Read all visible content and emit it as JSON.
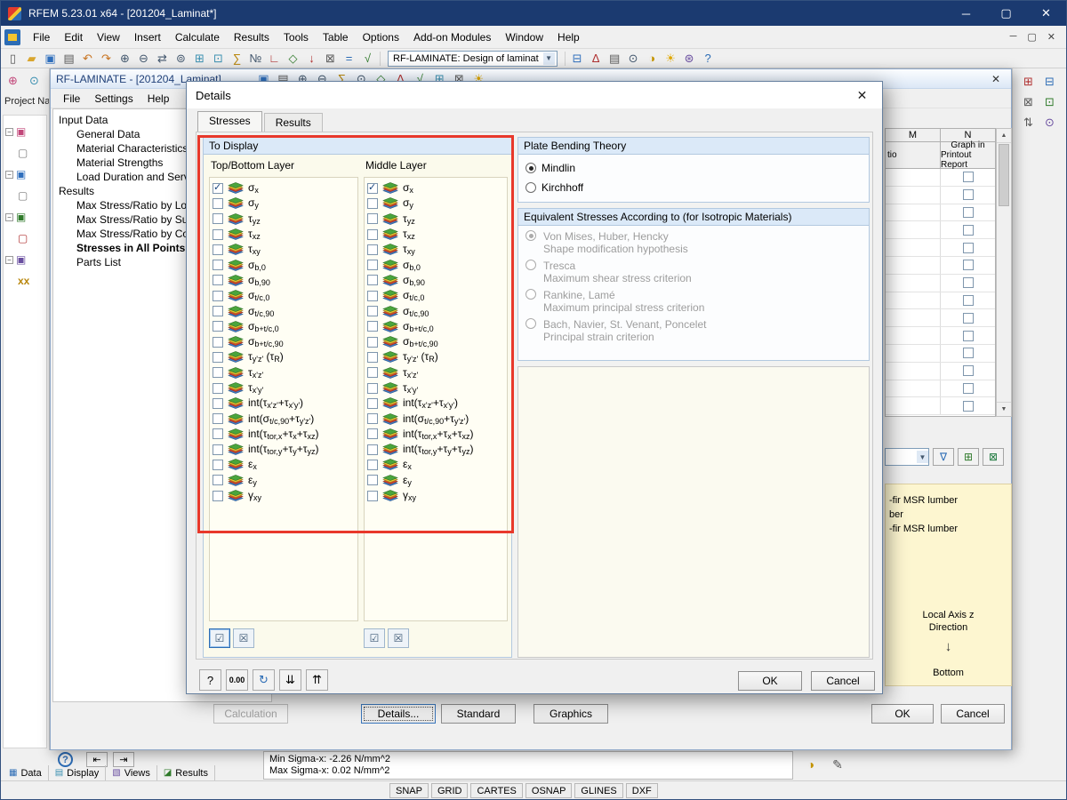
{
  "main_window": {
    "title": "RFEM 5.23.01 x64 - [201204_Laminat*]",
    "menu": [
      "File",
      "Edit",
      "View",
      "Insert",
      "Calculate",
      "Results",
      "Tools",
      "Table",
      "Options",
      "Add-on Modules",
      "Window",
      "Help"
    ]
  },
  "toolbar": {
    "module_selector": "RF-LAMINATE: Design of laminat",
    "icons_left": [
      {
        "name": "new-file-icon",
        "glyph": "▯",
        "color": "#5a5a5a"
      },
      {
        "name": "open-folder-icon",
        "glyph": "▰",
        "color": "#d9a62e"
      },
      {
        "name": "save-icon",
        "glyph": "▣",
        "color": "#2f6fbd"
      },
      {
        "name": "print-icon",
        "glyph": "▤",
        "color": "#5a5a5a"
      },
      {
        "name": "undo-icon",
        "glyph": "↶",
        "color": "#c8731f"
      },
      {
        "name": "redo-icon",
        "glyph": "↷",
        "color": "#c8731f"
      },
      {
        "name": "zoom-in-icon",
        "glyph": "⊕",
        "color": "#44586e"
      },
      {
        "name": "zoom-out-icon",
        "glyph": "⊖",
        "color": "#44586e"
      },
      {
        "name": "pan-icon",
        "glyph": "⇄",
        "color": "#44586e"
      },
      {
        "name": "rotate-view-icon",
        "glyph": "⊚",
        "color": "#44586e"
      },
      {
        "name": "grid-icon",
        "glyph": "⊞",
        "color": "#3a8fb0"
      },
      {
        "name": "snap-icon",
        "glyph": "⊡",
        "color": "#3a8fb0"
      },
      {
        "name": "sum-icon",
        "glyph": "∑",
        "color": "#b8860b"
      },
      {
        "name": "numbering-icon",
        "glyph": "№",
        "color": "#44586e"
      },
      {
        "name": "axes-icon",
        "glyph": "∟",
        "color": "#b03030"
      },
      {
        "name": "surface-icon",
        "glyph": "◇",
        "color": "#2f7a2a"
      },
      {
        "name": "load-icon",
        "glyph": "↓",
        "color": "#b03030"
      },
      {
        "name": "mesh-icon",
        "glyph": "⊠",
        "color": "#5a5a5a"
      },
      {
        "name": "calculate-icon",
        "glyph": "=",
        "color": "#2c6cb5"
      },
      {
        "name": "results-icon",
        "glyph": "√",
        "color": "#2f7a2a"
      }
    ],
    "icons_right": [
      {
        "name": "tables-icon",
        "glyph": "⊟",
        "color": "#2f6fbd"
      },
      {
        "name": "chart-icon",
        "glyph": "∆",
        "color": "#b03030"
      },
      {
        "name": "printout-report-icon",
        "glyph": "▤",
        "color": "#5a5a5a"
      },
      {
        "name": "camera-icon",
        "glyph": "⊙",
        "color": "#44586e"
      },
      {
        "name": "render-icon",
        "glyph": "◑",
        "color": "#c69500"
      },
      {
        "name": "light-icon",
        "glyph": "☀",
        "color": "#e0a800"
      },
      {
        "name": "modules-icon",
        "glyph": "⊛",
        "color": "#6a4fa0"
      },
      {
        "name": "help-icon",
        "glyph": "?",
        "color": "#2c6cb5"
      }
    ],
    "title_strip_icons": [
      {
        "name": "strip-save-icon",
        "glyph": "▣",
        "color": "#2f6fbd"
      },
      {
        "name": "strip-print-icon",
        "glyph": "▤",
        "color": "#5a5a5a"
      },
      {
        "name": "strip-zoom-in-icon",
        "glyph": "⊕",
        "color": "#44586e"
      },
      {
        "name": "strip-zoom-out-icon",
        "glyph": "⊖",
        "color": "#44586e"
      },
      {
        "name": "strip-sum-icon",
        "glyph": "∑",
        "color": "#b8860b"
      },
      {
        "name": "strip-camera-icon",
        "glyph": "⊙",
        "color": "#44586e"
      },
      {
        "name": "strip-surface-icon",
        "glyph": "◇",
        "color": "#2f7a2a"
      },
      {
        "name": "strip-chart-icon",
        "glyph": "∆",
        "color": "#b03030"
      },
      {
        "name": "strip-results-icon",
        "glyph": "√",
        "color": "#2f7a2a"
      },
      {
        "name": "strip-grid-icon",
        "glyph": "⊞",
        "color": "#3a8fb0"
      },
      {
        "name": "strip-mesh-icon",
        "glyph": "⊠",
        "color": "#5a5a5a"
      },
      {
        "name": "strip-light-icon",
        "glyph": "☀",
        "color": "#e0a800"
      }
    ],
    "side_icons": [
      {
        "name": "side-display-icon",
        "glyph": "⊞",
        "color": "#b03030"
      },
      {
        "name": "side-views-icon",
        "glyph": "⊟",
        "color": "#2c6cb5"
      },
      {
        "name": "side-mesh-icon",
        "glyph": "⊠",
        "color": "#5a5a5a"
      },
      {
        "name": "side-results-icon",
        "glyph": "⊡",
        "color": "#2f7a2a"
      },
      {
        "name": "side-sort-icon",
        "glyph": "⇅",
        "color": "#5a5a5a"
      },
      {
        "name": "side-render-icon",
        "glyph": "⊙",
        "color": "#6a4fa0"
      }
    ]
  },
  "project_navigator": {
    "title": "Project Na",
    "dock_icons": [
      {
        "name": "new-model-icon",
        "glyph": "⊕",
        "color": "#c2477a"
      },
      {
        "name": "open-model-icon",
        "glyph": "⊙",
        "color": "#3a8fb0"
      }
    ],
    "nodes": [
      {
        "name": "model-node-icon",
        "glyph": "▣",
        "color": "#c2477a",
        "expander": true
      },
      {
        "name": "sections-node-icon",
        "glyph": "▢",
        "color": "#7a7a7a",
        "expander": false
      },
      {
        "name": "materials-node-icon",
        "glyph": "▣",
        "color": "#2f6fbd",
        "expander": true
      },
      {
        "name": "nodes-node-icon",
        "glyph": "▢",
        "color": "#7a7a7a",
        "expander": false
      },
      {
        "name": "lines-node-icon",
        "glyph": "▣",
        "color": "#2f7a2a",
        "expander": true
      },
      {
        "name": "loads-node-icon",
        "glyph": "▢",
        "color": "#b03030",
        "expander": false
      },
      {
        "name": "results-node-icon",
        "glyph": "▣",
        "color": "#6a4fa0",
        "expander": true
      },
      {
        "name": "tables-node-icon",
        "glyph": "xx",
        "color": "#b8860b",
        "expander": false
      }
    ]
  },
  "module_window": {
    "title": "RF-LAMINATE - [201204_Laminat]",
    "menu": [
      "File",
      "Settings",
      "Help"
    ],
    "navigator": {
      "sections": [
        {
          "label": "Input Data",
          "children": [
            "General Data",
            "Material Characteristics",
            "Material Strengths",
            "Load Duration and Service"
          ]
        },
        {
          "label": "Results",
          "children": [
            "Max Stress/Ratio by Load",
            "Max Stress/Ratio by Surfa",
            "Max Stress/Ratio by Comp",
            "Stresses in All Points",
            "Parts List"
          ]
        }
      ],
      "selected": "Stresses in All Points"
    },
    "results_table": {
      "columns": [
        "M",
        "N"
      ],
      "sub_left": "tio",
      "sub_right_line1": "Graph in",
      "sub_right_line2": "Printout Report",
      "row_count": 14
    },
    "info_panel": {
      "lines": [
        "-fir MSR lumber",
        "ber",
        "-fir MSR lumber"
      ],
      "axis_caption_line1": "Local Axis z",
      "axis_caption_line2": "Direction",
      "axis_position": "Bottom"
    },
    "buttons": {
      "calculation": "Calculation",
      "details": "Details...",
      "standard": "Standard",
      "graphics": "Graphics",
      "ok": "OK",
      "cancel": "Cancel"
    },
    "status": {
      "min": "Min Sigma-x: -2.26 N/mm^2",
      "max": "Max Sigma-x: 0.02 N/mm^2"
    }
  },
  "details_dialog": {
    "title": "Details",
    "tabs": [
      "Stresses",
      "Results"
    ],
    "annotation_color": "#e8382b",
    "to_display": {
      "title": "To Display",
      "column_headers": [
        "Top/Bottom Layer",
        "Middle Layer"
      ],
      "items": [
        {
          "label": "σ_x_",
          "checked": true
        },
        {
          "label": "σ_y_",
          "checked": false
        },
        {
          "label": "τ_yz_",
          "checked": false
        },
        {
          "label": "τ_xz_",
          "checked": false
        },
        {
          "label": "τ_xy_",
          "checked": false
        },
        {
          "label": "σ_b,0_",
          "checked": false
        },
        {
          "label": "σ_b,90_",
          "checked": false
        },
        {
          "label": "σ_t/c,0_",
          "checked": false
        },
        {
          "label": "σ_t/c,90_",
          "checked": false
        },
        {
          "label": "σ_b+t/c,0_",
          "checked": false
        },
        {
          "label": "σ_b+t/c,90_",
          "checked": false
        },
        {
          "label": "τ_y'z'_ (τ_R_)",
          "checked": false
        },
        {
          "label": "τ_x'z'_",
          "checked": false
        },
        {
          "label": "τ_x'y'_",
          "checked": false
        },
        {
          "label": "int(τ_x'z'_+τ_x'y'_)",
          "checked": false
        },
        {
          "label": "int(σ_t/c,90_+τ_y'z'_)",
          "checked": false
        },
        {
          "label": "int(τ_tor,x_+τ_x_+τ_xz_)",
          "checked": false
        },
        {
          "label": "int(τ_tor,y_+τ_y_+τ_yz_)",
          "checked": false
        },
        {
          "label": "ε_x_",
          "checked": false
        },
        {
          "label": "ε_y_",
          "checked": false
        },
        {
          "label": "γ_xy_",
          "checked": false
        }
      ]
    },
    "plate_bending_theory": {
      "title": "Plate Bending Theory",
      "options": [
        {
          "label": "Mindlin",
          "selected": true
        },
        {
          "label": "Kirchhoff",
          "selected": false
        }
      ]
    },
    "equivalent_stresses": {
      "title": "Equivalent Stresses According to (for Isotropic Materials)",
      "disabled": true,
      "options": [
        {
          "label": "Von Mises, Huber, Hencky",
          "description": "Shape modification hypothesis",
          "selected": true
        },
        {
          "label": "Tresca",
          "description": "Maximum shear stress criterion",
          "selected": false
        },
        {
          "label": "Rankine, Lamé",
          "description": "Maximum principal stress criterion",
          "selected": false
        },
        {
          "label": "Bach, Navier, St. Venant, Poncelet",
          "description": "Principal strain criterion",
          "selected": false
        }
      ]
    },
    "units_button": "0.00",
    "ok": "OK",
    "cancel": "Cancel"
  },
  "bottom_bar": {
    "panel_tabs": [
      {
        "label": "Data",
        "glyph": "▦",
        "color": "#2c6cb5"
      },
      {
        "label": "Display",
        "glyph": "▤",
        "color": "#3a8fb0"
      },
      {
        "label": "Views",
        "glyph": "▧",
        "color": "#6a4fa0"
      },
      {
        "label": "Results",
        "glyph": "◪",
        "color": "#2f7a2a"
      }
    ]
  },
  "statusbar": {
    "toggles": [
      "SNAP",
      "GRID",
      "CARTES",
      "OSNAP",
      "GLINES",
      "DXF"
    ]
  }
}
